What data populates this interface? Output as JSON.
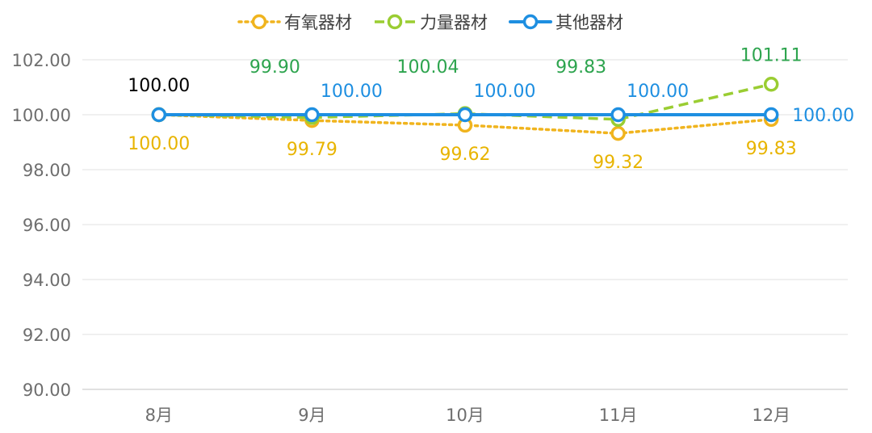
{
  "chart_data": {
    "type": "line",
    "categories": [
      "8月",
      "9月",
      "10月",
      "11月",
      "12月"
    ],
    "ylim": [
      90,
      102
    ],
    "yticks": [
      "90.00",
      "92.00",
      "94.00",
      "96.00",
      "98.00",
      "100.00",
      "102.00"
    ],
    "grid": true,
    "legend_position": "top-center",
    "series": [
      {
        "name": "有氧器材",
        "values": [
          100.0,
          99.79,
          99.62,
          99.32,
          99.83
        ],
        "labels": [
          "100.00",
          "99.79",
          "99.62",
          "99.32",
          "99.83"
        ],
        "color": "#F0B41E",
        "label_color": "#E8B400",
        "dash": "dotted"
      },
      {
        "name": "力量器材",
        "values": [
          100.0,
          99.9,
          100.04,
          99.83,
          101.11
        ],
        "labels": [
          "",
          "99.90",
          "100.04",
          "99.83",
          "101.11"
        ],
        "color": "#9ACD32",
        "label_color": "#2DA44E",
        "dash": "dashed"
      },
      {
        "name": "其他器材",
        "values": [
          100.0,
          100.0,
          100.0,
          100.0,
          100.0
        ],
        "labels": [
          "",
          "100.00",
          "100.00",
          "100.00",
          "100.00"
        ],
        "color": "#1E8FE1",
        "label_color": "#1E8FE1",
        "dash": "solid"
      }
    ],
    "first_point_label": "100.00",
    "first_point_label_color": "#000000"
  }
}
